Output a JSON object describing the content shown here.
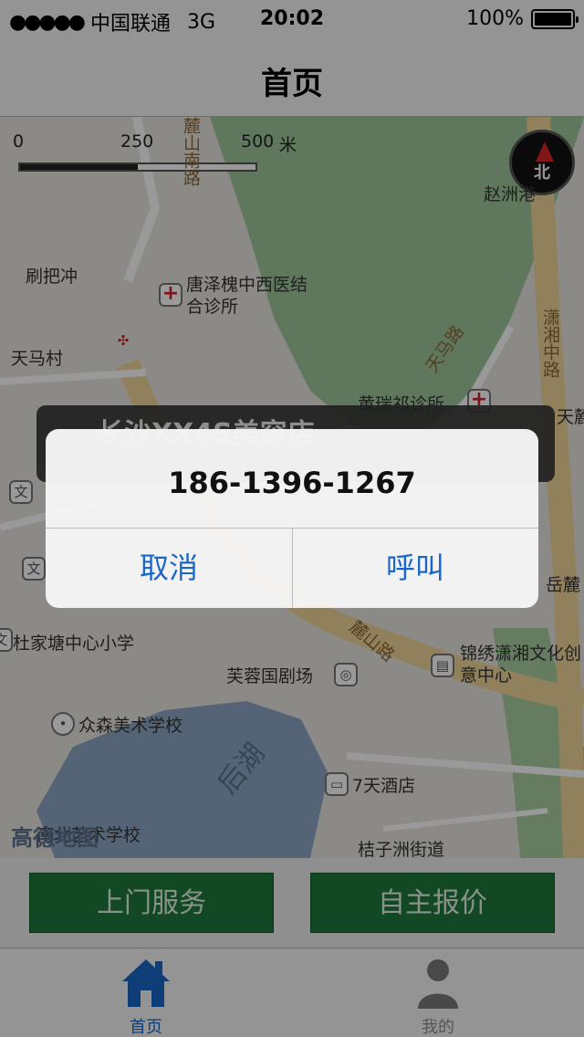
{
  "status_bar": {
    "signal": "●●●●●",
    "carrier": "中国联通",
    "network": "3G",
    "time": "20:02",
    "battery_text": "100%",
    "battery_level": 1.0
  },
  "nav_bar": {
    "title": "首页"
  },
  "map": {
    "scale": {
      "label_0": "0",
      "label_250": "250",
      "label_500": "500",
      "unit": "米"
    },
    "compass_label": "北",
    "labels": {
      "lulu_road": "麓山南路",
      "zhaozhou": "赵洲港",
      "shuabachong": "刷把冲",
      "clinic": "唐泽槐中西医结合诊所",
      "tianmacun": "天马村",
      "tianma_road": "天马路",
      "xiaoxiang_mid": "潇湘中路",
      "huangrui": "黄瑞祁诊所",
      "tianlong": "天麓",
      "yuelu": "岳麓",
      "dujiatang": "杜家塘中心小学",
      "furong": "芙蓉国剧场",
      "xiangxiu": "锦绣潇湘文化创意中心",
      "zhongsen": "众森美术学校",
      "houhu": "后湖",
      "inn": "7天酒店",
      "nanbei": "南北艺术学校",
      "juzizhou": "桔子洲街道",
      "lushan_road": "麓山路",
      "logo": "高德地图"
    },
    "callout_text": "长沙XX4S美容店"
  },
  "actions": {
    "home_service": "上门服务",
    "self_quote": "自主报价"
  },
  "tabs": {
    "home": "首页",
    "mine": "我的"
  },
  "alert": {
    "message": "186-1396-1267",
    "cancel": "取消",
    "call": "呼叫"
  },
  "colors": {
    "accent": "#1a67c8",
    "action_green": "#1f7a3c",
    "map_green": "#9ec79b",
    "lake": "#8ea5c6",
    "road": "#f0d79a"
  }
}
